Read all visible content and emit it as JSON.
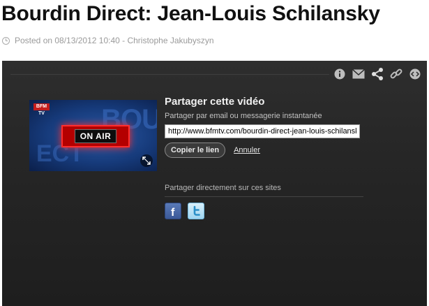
{
  "page": {
    "title": "Bourdin Direct: Jean-Louis Schilansky",
    "posted_meta": "Posted on 08/13/2012 10:40 - Christophe Jakubyszyn"
  },
  "player": {
    "toolbar_icons": [
      "info-icon",
      "email-icon",
      "share-icon",
      "link-icon",
      "embed-icon"
    ],
    "thumbnail": {
      "channel_logo": "BFM TV",
      "banner_text": "ON AIR",
      "background_text": "BOU",
      "background_text_2": "ECT"
    },
    "share_panel": {
      "heading": "Partager cette vidéo",
      "subheading": "Partager par email ou messagerie instantanée",
      "url_value": "http://www.bfmtv.com/bourdin-direct-jean-louis-schilansky",
      "copy_label": "Copier le lien",
      "cancel_label": "Annuler",
      "direct_label": "Partager directement sur ces sites",
      "sites": [
        "facebook-icon",
        "twitter-icon"
      ]
    }
  },
  "colors": {
    "player_bg": "#262626",
    "facebook": "#3b5998",
    "twitter": "#9ed4f0",
    "onair_red": "#b40000"
  }
}
